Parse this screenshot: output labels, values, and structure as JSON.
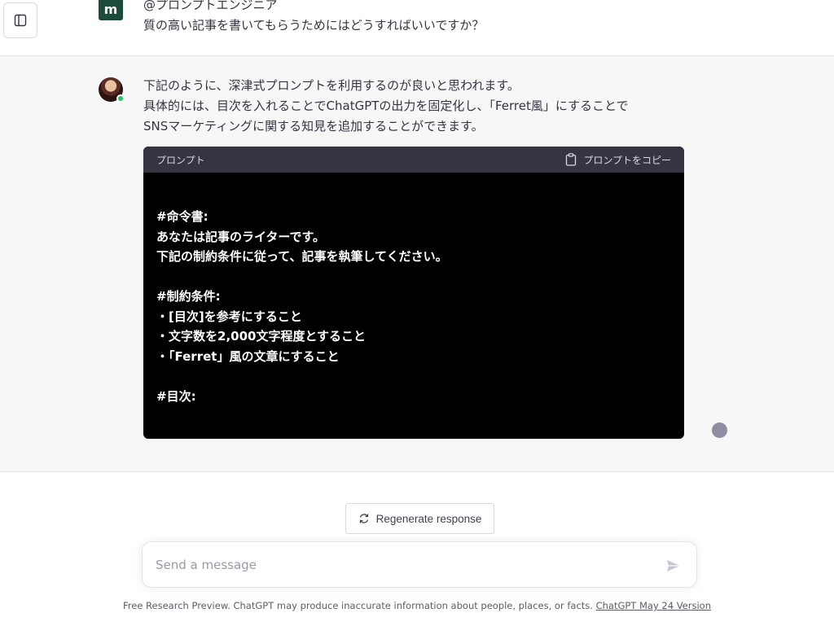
{
  "sidebar": {
    "toggle_icon": "sidebar-icon"
  },
  "user_message": {
    "avatar_letter": "m",
    "mention": "@プロンプトエンジニア",
    "question": "質の高い記事を書いてもらうためにはどうすればいいですか？"
  },
  "assistant_message": {
    "lines": [
      "下記のように、深津式プロンプトを利用するのが良いと思われます。",
      "具体的には、目次を入れることでChatGPTの出力を固定化し、「Ferret風」にすることで",
      "SNSマーケティングに関する知見を追加することができます。"
    ],
    "code_block": {
      "label": "プロンプト",
      "copy_label": "プロンプトをコピー",
      "copy_icon": "clipboard-icon",
      "content": "#命令書:\nあなたは記事のライターです。\n下記の制約条件に従って、記事を執筆してください。\n\n#制約条件:\n・[目次]を参考にすること\n・文字数を2,000文字程度とすること\n・「Ferret」風の文章にすること\n\n#目次:"
    }
  },
  "regenerate": {
    "label": "Regenerate response",
    "icon": "refresh-icon"
  },
  "composer": {
    "placeholder": "Send a message",
    "send_icon": "paper-plane-icon"
  },
  "footer": {
    "text": "Free Research Preview. ChatGPT may produce inaccurate information about people, places, or facts. ",
    "link_text": "ChatGPT May 24 Version"
  },
  "colors": {
    "user_avatar_bg": "#1c4a3b",
    "assistant_bg": "#f7f7f8",
    "code_header_bg": "#343541",
    "code_bg": "#000000",
    "online": "#22c55e"
  }
}
